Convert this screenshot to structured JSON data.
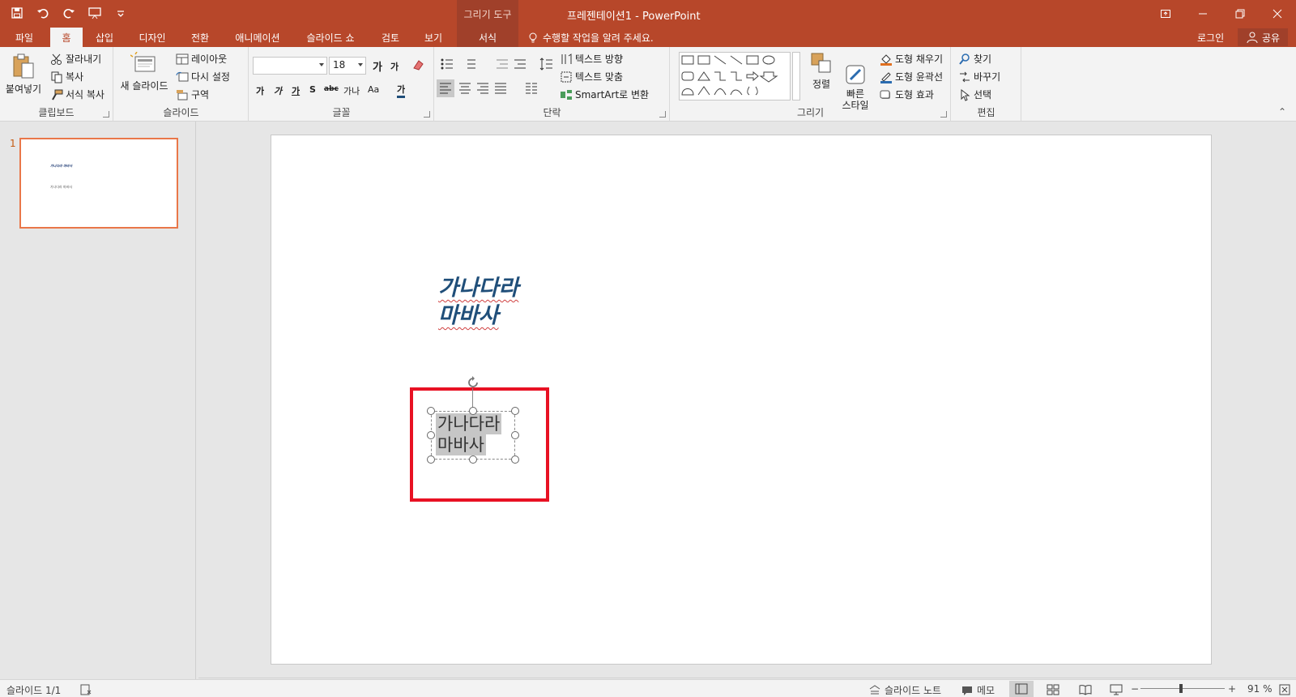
{
  "titlebar": {
    "context_tab_header": "그리기 도구",
    "doc_title": "프레젠테이션1 - PowerPoint"
  },
  "tabs": [
    {
      "label": "파일"
    },
    {
      "label": "홈"
    },
    {
      "label": "삽입"
    },
    {
      "label": "디자인"
    },
    {
      "label": "전환"
    },
    {
      "label": "애니메이션"
    },
    {
      "label": "슬라이드 쇼"
    },
    {
      "label": "검토"
    },
    {
      "label": "보기"
    },
    {
      "label": "서식"
    }
  ],
  "tellme": "수행할 작업을 알려 주세요.",
  "login": "로그인",
  "share": "공유",
  "ribbon": {
    "clipboard": {
      "label": "클립보드",
      "paste": "붙여넣기",
      "cut": "잘라내기",
      "copy": "복사",
      "format_painter": "서식 복사"
    },
    "slides": {
      "label": "슬라이드",
      "new_slide": "새 슬라이드",
      "layout": "레이아웃",
      "reset": "다시 설정",
      "section": "구역"
    },
    "font": {
      "label": "글꼴",
      "font_name": "",
      "font_size": "18",
      "grow": "가",
      "shrink": "가",
      "bold": "가",
      "italic": "가",
      "underline": "가",
      "shadow": "S",
      "strike": "abc",
      "spacing": "가나",
      "case": "Aa",
      "color": "가"
    },
    "paragraph": {
      "label": "단락",
      "text_direction": "텍스트 방향",
      "align_text": "텍스트 맞춤",
      "smartart": "SmartArt로 변환"
    },
    "drawing": {
      "label": "그리기",
      "arrange": "정렬",
      "quick_styles": "빠른\n스타일",
      "fill": "도형 채우기",
      "outline": "도형 윤곽선",
      "effects": "도형 효과"
    },
    "editing": {
      "label": "편집",
      "find": "찾기",
      "replace": "바꾸기",
      "select": "선택"
    }
  },
  "thumbnails": [
    {
      "number": "1",
      "title": "가나다라 마바사",
      "body": "가나다라 마바사"
    }
  ],
  "slide": {
    "title_lines": [
      "가나다라",
      "마바사"
    ],
    "body_lines": [
      "가나다라",
      "마바사"
    ]
  },
  "status": {
    "slide_info": "슬라이드 1/1",
    "notes": "슬라이드 노트",
    "comments": "메모",
    "zoom": "91 %",
    "zoom_level": 0.91
  },
  "colors": {
    "accent": "#b7472a",
    "highlight": "#e81123"
  }
}
